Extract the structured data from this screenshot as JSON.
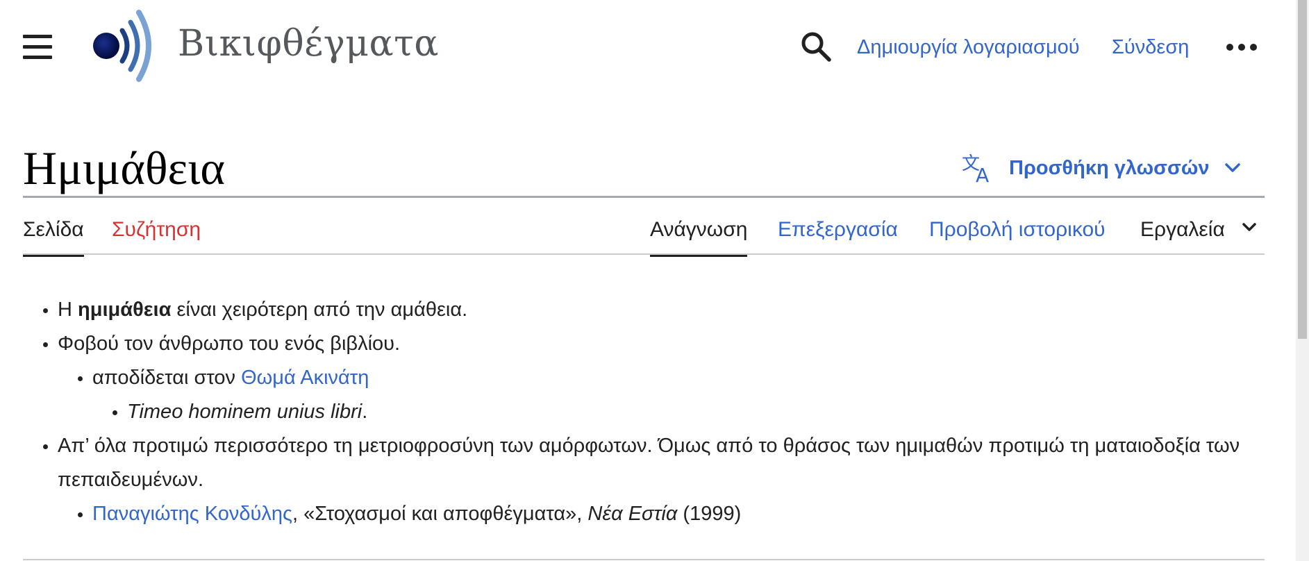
{
  "header": {
    "wordmark": "Βικιφθέγματα",
    "create_account": "Δημιουργία λογαριασμού",
    "login": "Σύνδεση",
    "icons": {
      "menu": "hamburger-menu-icon",
      "logo": "wikiquote-logo-icon",
      "search": "search-icon",
      "more": "ellipsis-icon"
    }
  },
  "page": {
    "title": "Ημιμάθεια",
    "add_languages": "Προσθήκη γλωσσών"
  },
  "tabs": {
    "page": "Σελίδα",
    "talk": "Συζήτηση",
    "read": "Ανάγνωση",
    "edit": "Επεξεργασία",
    "history": "Προβολή ιστορικού",
    "tools": "Εργαλεία"
  },
  "content": {
    "q1": {
      "before": "Η ",
      "bold": "ημιμάθεια",
      "after": " είναι χειρότερη από την αμάθεια."
    },
    "q2": {
      "text": "Φοβού τον άνθρωπο του ενός βιβλίου.",
      "attribution_prefix": "αποδίδεται στον ",
      "attribution_link": "Θωμά Ακινάτη",
      "original_italic": "Timeo hominem unius libri",
      "original_suffix": "."
    },
    "q3": {
      "text": "Απ’ όλα προτιμώ περισσότερο τη μετριοφροσύνη των αμόρφωτων. Όμως από το θράσος των ημιμαθών προτιμώ τη ματαιοδοξία των πεπαιδευμένων.",
      "source_link": "Παναγιώτης Κονδύλης",
      "source_text": ", «Στοχασμοί και αποφθέγματα», ",
      "source_italic": "Νέα Εστία",
      "source_year": " (1999)"
    }
  },
  "colors": {
    "link": "#3366cc",
    "new_link": "#d73333",
    "text": "#202122",
    "wordmark": "#54595d",
    "border": "#a2a9b1"
  }
}
